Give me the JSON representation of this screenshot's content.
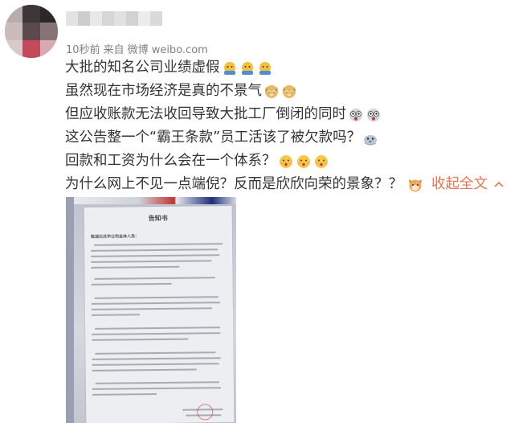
{
  "post": {
    "meta": {
      "time": "10秒前",
      "source_prefix": "来自",
      "source": "微博 weibo.com"
    },
    "lines": [
      "大批的知名公司业绩虚假",
      "虽然现在市场经济是真的不景气",
      "但应收账款无法收回导致大批工厂倒闭的同时",
      "这公告整一个“霸王条款”员工活该了被欠款吗？",
      "回款和工资为什么会在一个体系？",
      "为什么网上不见一点端倪？反而是欣欣向荣的景象？？"
    ],
    "collapse_label": "收起全文",
    "collapse_chevron": "^",
    "emoji_names": [
      "broke-emoji",
      "tired-doge-emoji",
      "shocked-emoji",
      "seal-emoji",
      "thinking-emoji",
      "cat-emoji"
    ],
    "image": {
      "notice_title": "告知书",
      "notice_addressee": "致湖北兑华公司全体人员："
    }
  }
}
